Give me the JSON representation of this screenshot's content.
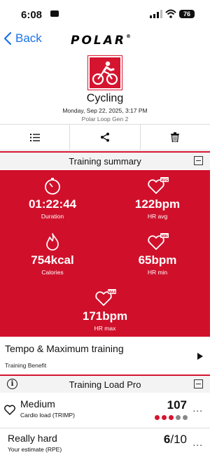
{
  "status": {
    "time": "6:08",
    "battery": "76"
  },
  "nav": {
    "back_label": "Back",
    "logo": "POLAR",
    "logo_mark": "®"
  },
  "session": {
    "sport": "Cycling",
    "date": "Monday, Sep 22, 2025, 3:17 PM",
    "device": "Polar Loop Gen 2"
  },
  "training_summary": {
    "title": "Training summary",
    "metrics": {
      "duration": {
        "value": "01:22:44",
        "unit": "",
        "label": "Duration",
        "icon": "stopwatch-icon"
      },
      "hr_avg": {
        "value": "122",
        "unit": "bpm",
        "label": "HR avg",
        "icon": "heart-avg-icon",
        "badge": "AVG"
      },
      "calories": {
        "value": "754",
        "unit": "kcal",
        "label": "Calories",
        "icon": "flame-icon"
      },
      "hr_min": {
        "value": "65",
        "unit": "bpm",
        "label": "HR min",
        "icon": "heart-min-icon",
        "badge": "MIN"
      },
      "hr_max": {
        "value": "171",
        "unit": "bpm",
        "label": "HR max",
        "icon": "heart-max-icon",
        "badge": "MAX"
      }
    }
  },
  "training_benefit": {
    "title": "Tempo & Maximum training",
    "label": "Training Benefit"
  },
  "training_load": {
    "title": "Training Load Pro",
    "info_glyph": "i",
    "cardio": {
      "level": "Medium",
      "label": "Cardio load (TRIMP)",
      "value": "107",
      "dots_filled": 3,
      "dots_total": 5
    },
    "rpe": {
      "level": "Really hard",
      "label": "Your estimate (RPE)",
      "score": "6",
      "max": "/10"
    },
    "more_glyph": "..."
  },
  "colors": {
    "accent": "#d5152f",
    "summary_bg": "#d0102b",
    "link": "#1a73e8"
  }
}
